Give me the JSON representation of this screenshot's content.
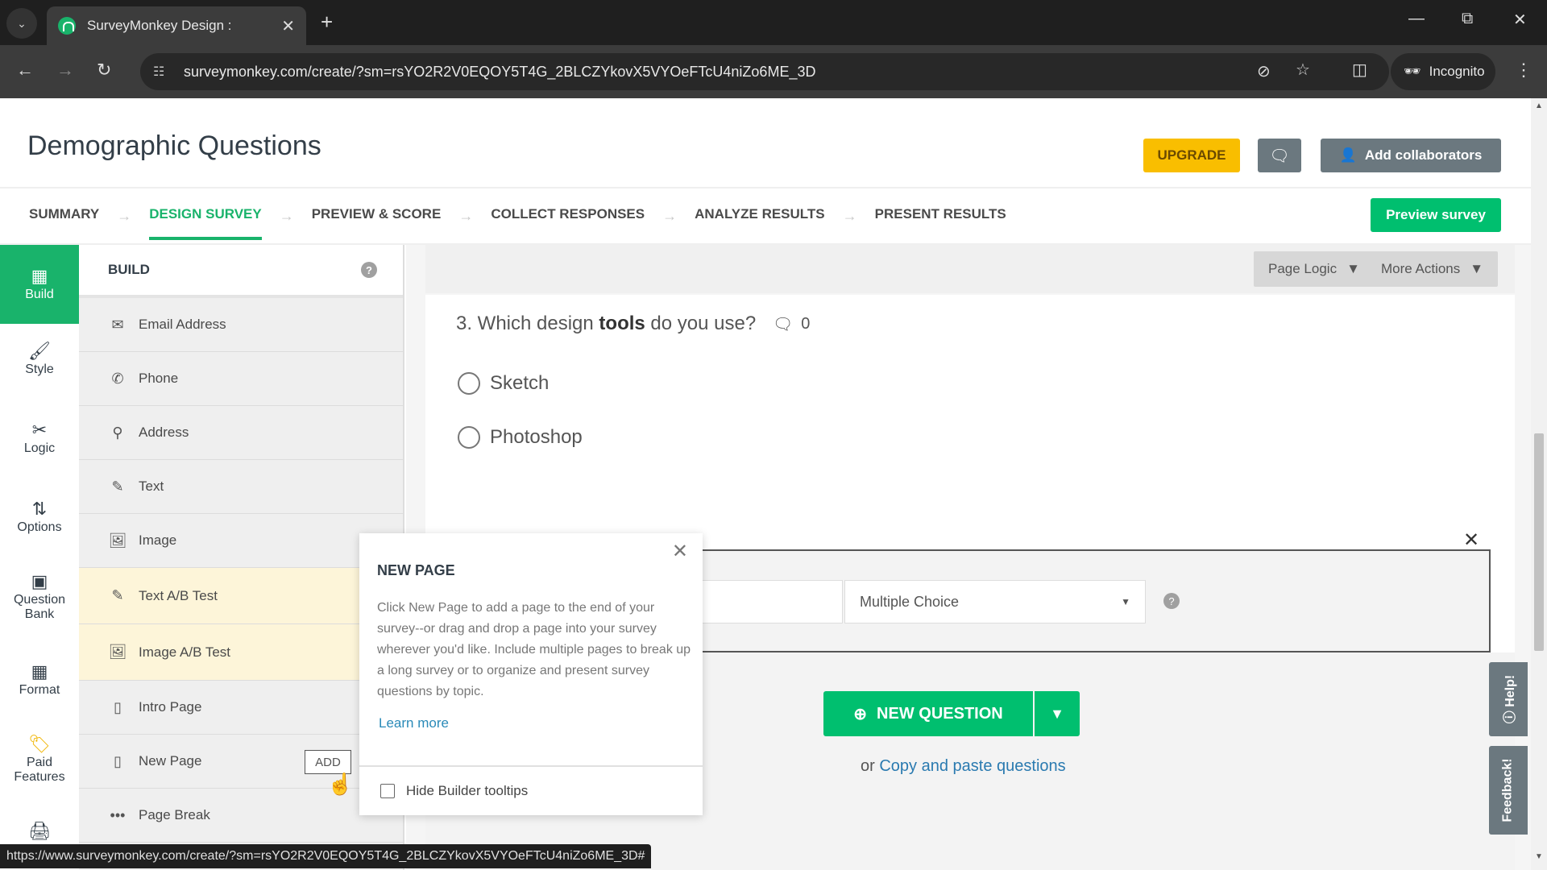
{
  "browser": {
    "tab_title": "SurveyMonkey Design :",
    "url": "surveymonkey.com/create/?sm=rsYO2R2V0EQOY5T4G_2BLCZYkovX5VYOeFTcU4niZo6ME_3D",
    "incognito_label": "Incognito",
    "status_url": "https://www.surveymonkey.com/create/?sm=rsYO2R2V0EQOY5T4G_2BLCZYkovX5VYOeFTcU4niZo6ME_3D#"
  },
  "header": {
    "survey_title": "Demographic Questions",
    "upgrade_label": "UPGRADE",
    "add_collaborators_label": "Add collaborators",
    "preview_label": "Preview survey"
  },
  "steps": [
    {
      "label": "SUMMARY",
      "active": false
    },
    {
      "label": "DESIGN SURVEY",
      "active": true
    },
    {
      "label": "PREVIEW & SCORE",
      "active": false
    },
    {
      "label": "COLLECT RESPONSES",
      "active": false
    },
    {
      "label": "ANALYZE RESULTS",
      "active": false
    },
    {
      "label": "PRESENT RESULTS",
      "active": false
    }
  ],
  "rail": [
    {
      "label": "Build",
      "icon": "build-icon",
      "active": true
    },
    {
      "label": "Style",
      "icon": "brush-icon"
    },
    {
      "label": "Logic",
      "icon": "logic-icon"
    },
    {
      "label": "Options",
      "icon": "sliders-icon"
    },
    {
      "label": "Question Bank",
      "icon": "question-bank-icon"
    },
    {
      "label": "Format",
      "icon": "format-icon"
    },
    {
      "label": "Paid Features",
      "icon": "tag-icon"
    },
    {
      "label": "",
      "icon": "print-icon"
    }
  ],
  "build_panel": {
    "title": "BUILD",
    "items": [
      {
        "label": "Email Address",
        "icon": "email-icon"
      },
      {
        "label": "Phone",
        "icon": "phone-icon"
      },
      {
        "label": "Address",
        "icon": "location-icon"
      },
      {
        "label": "Text",
        "icon": "edit-icon"
      },
      {
        "label": "Image",
        "icon": "image-icon"
      },
      {
        "label": "Text A/B Test",
        "icon": "edit-icon",
        "paid": true
      },
      {
        "label": "Image A/B Test",
        "icon": "image-icon",
        "paid": true
      },
      {
        "label": "Intro Page",
        "icon": "page-icon"
      },
      {
        "label": "New Page",
        "icon": "page-icon"
      },
      {
        "label": "Page Break",
        "icon": "dots-icon"
      }
    ],
    "add_label": "ADD"
  },
  "canvas": {
    "page_logic_label": "Page Logic",
    "more_actions_label": "More Actions",
    "question_prefix": "3. Which design ",
    "question_bold": "tools",
    "question_suffix": " do you use?",
    "comment_count": "0",
    "choices": [
      "Sketch",
      "Photoshop"
    ],
    "question_type": "Multiple Choice",
    "new_question_label": "NEW QUESTION",
    "copy_paste_prefix": "or",
    "copy_paste_link": "Copy and paste questions"
  },
  "tooltip": {
    "title": "NEW PAGE",
    "body": "Click New Page to add a page to the end of your survey--or drag and drop a page into your survey wherever you'd like. Include multiple pages to break up a long survey or to organize and present survey questions by topic.",
    "learn_more": "Learn more",
    "hide_label": "Hide Builder tooltips",
    "hide_checked": false
  },
  "side_tabs": {
    "help": "Help!",
    "feedback": "Feedback!"
  },
  "colors": {
    "brand_green": "#00bf6f",
    "upgrade_yellow": "#f9be00",
    "paid_highlight": "#fdf5d9",
    "gray_button": "#6b787f"
  }
}
